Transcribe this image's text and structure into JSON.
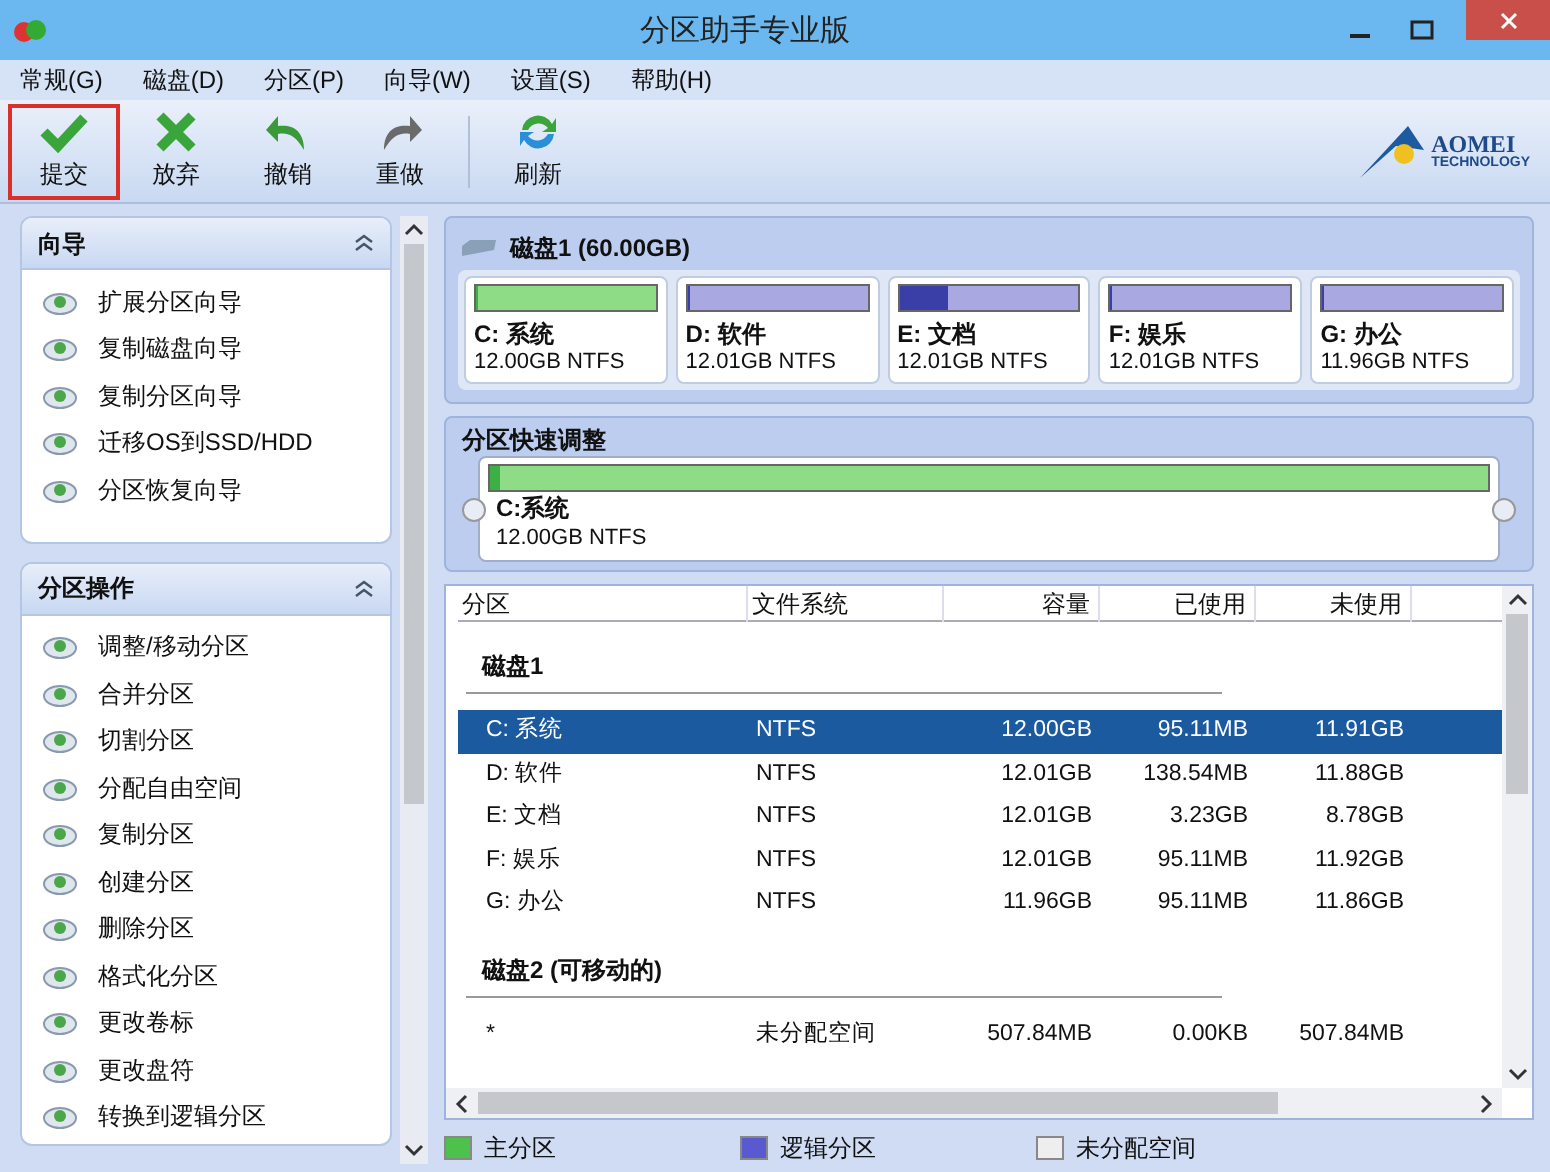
{
  "window": {
    "title": "分区助手专业版"
  },
  "menu": [
    "常规(G)",
    "磁盘(D)",
    "分区(P)",
    "向导(W)",
    "设置(S)",
    "帮助(H)"
  ],
  "toolbar": [
    {
      "kind": "check",
      "label": "提交",
      "highlighted": true
    },
    {
      "kind": "discard",
      "label": "放弃",
      "highlighted": false
    },
    {
      "kind": "undo",
      "label": "撤销",
      "highlighted": false
    },
    {
      "kind": "redo",
      "label": "重做",
      "highlighted": false
    },
    {
      "kind": "refresh",
      "label": "刷新",
      "highlighted": false
    }
  ],
  "logo": {
    "name": "AOMEI",
    "sub": "TECHNOLOGY"
  },
  "sidebar": [
    {
      "title": "向导",
      "expanded": true,
      "items": [
        "扩展分区向导",
        "复制磁盘向导",
        "复制分区向导",
        "迁移OS到SSD/HDD",
        "分区恢复向导"
      ]
    },
    {
      "title": "分区操作",
      "expanded": true,
      "items": [
        "调整/移动分区",
        "合并分区",
        "切割分区",
        "分配自由空间",
        "复制分区",
        "创建分区",
        "删除分区",
        "格式化分区",
        "更改卷标",
        "更改盘符",
        "转换到逻辑分区"
      ]
    }
  ],
  "disk": {
    "title": "磁盘1 (60.00GB)",
    "partitions": [
      {
        "kind": "primary",
        "name": "C: 系统",
        "info": "12.00GB NTFS",
        "level": 0.01
      },
      {
        "kind": "logical",
        "name": "D: 软件",
        "info": "12.01GB NTFS",
        "level": 0.01
      },
      {
        "kind": "logical",
        "name": "E: 文档",
        "info": "12.01GB NTFS",
        "level": 0.27
      },
      {
        "kind": "logical",
        "name": "F: 娱乐",
        "info": "12.01GB NTFS",
        "level": 0.01
      },
      {
        "kind": "logical",
        "name": "G: 办公",
        "info": "11.96GB NTFS",
        "level": 0.01
      }
    ]
  },
  "quick_adjust": {
    "title": "分区快速调整",
    "name": "C:系统",
    "info": "12.00GB NTFS",
    "level": 0.01
  },
  "table": {
    "columns": [
      "分区",
      "文件系统",
      "容量",
      "已使用",
      "未使用"
    ],
    "groups": [
      {
        "title": "磁盘1",
        "rows": [
          {
            "cells": [
              "C: 系统",
              "NTFS",
              "12.00GB",
              "95.11MB",
              "11.91GB"
            ],
            "selected": true
          },
          {
            "cells": [
              "D: 软件",
              "NTFS",
              "12.01GB",
              "138.54MB",
              "11.88GB"
            ],
            "selected": false
          },
          {
            "cells": [
              "E: 文档",
              "NTFS",
              "12.01GB",
              "3.23GB",
              "8.78GB"
            ],
            "selected": false
          },
          {
            "cells": [
              "F: 娱乐",
              "NTFS",
              "12.01GB",
              "95.11MB",
              "11.92GB"
            ],
            "selected": false
          },
          {
            "cells": [
              "G: 办公",
              "NTFS",
              "11.96GB",
              "95.11MB",
              "11.86GB"
            ],
            "selected": false
          }
        ]
      },
      {
        "title": "磁盘2 (可移动的)",
        "rows": [
          {
            "cells": [
              "*",
              "未分配空间",
              "507.84MB",
              "0.00KB",
              "507.84MB"
            ],
            "selected": false
          }
        ]
      }
    ]
  },
  "legend": [
    {
      "kind": "primary",
      "label": "主分区"
    },
    {
      "kind": "logical",
      "label": "逻辑分区"
    },
    {
      "kind": "unallocated",
      "label": "未分配空间"
    }
  ]
}
